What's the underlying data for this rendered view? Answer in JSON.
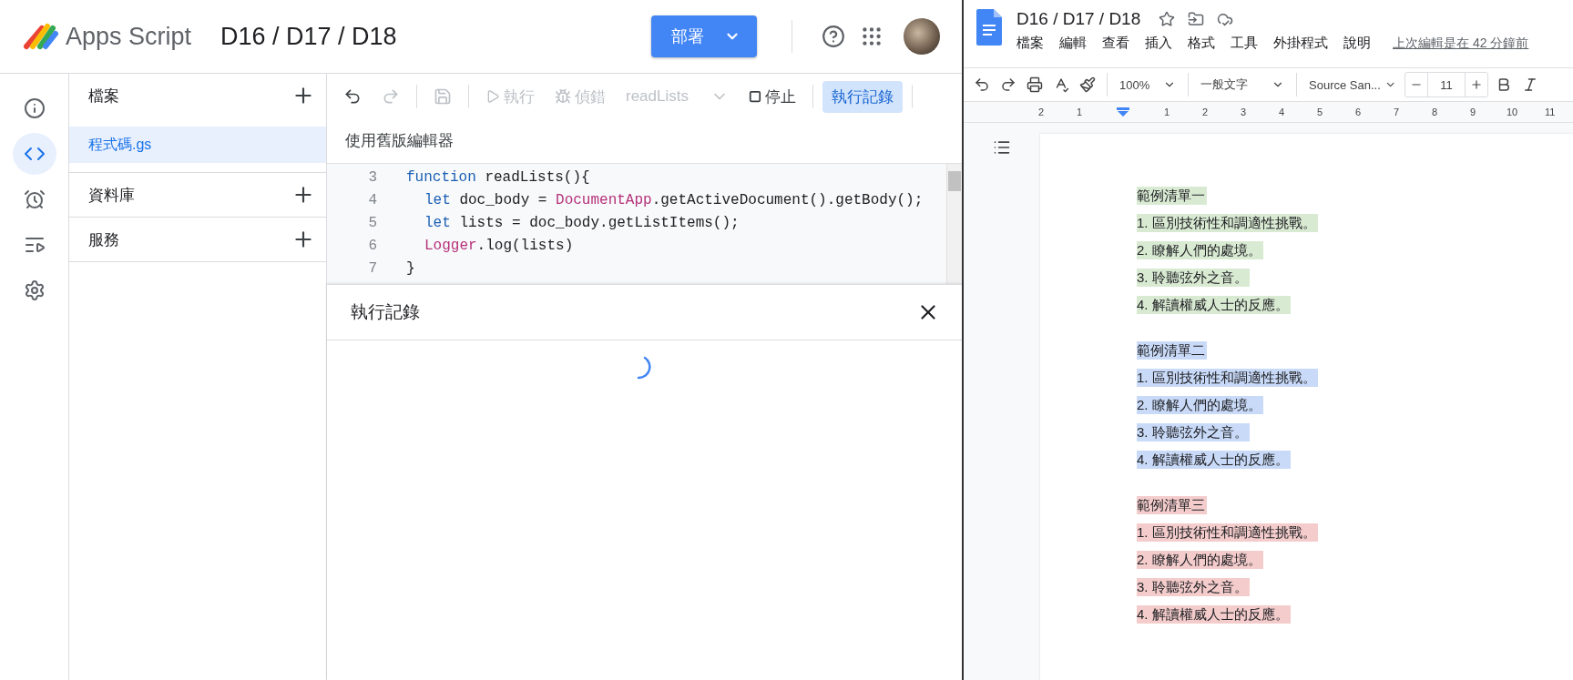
{
  "apps_script": {
    "brand": "Apps Script",
    "project_title": "D16 / D17 / D18",
    "deploy_button": "部署",
    "rail": [
      {
        "selected": false
      },
      {
        "selected": true
      },
      {
        "selected": false
      },
      {
        "selected": false
      },
      {
        "selected": false
      }
    ],
    "sections": [
      {
        "title": "檔案",
        "files": [
          {
            "name": "程式碼.gs",
            "selected": true
          }
        ]
      },
      {
        "title": "資料庫"
      },
      {
        "title": "服務"
      }
    ],
    "toolbar": {
      "run": {
        "label": "執行",
        "disabled": true
      },
      "debug": {
        "label": "偵錯",
        "disabled": true
      },
      "function_select": "readLists",
      "stop": "停止",
      "log_button": {
        "label": "執行記錄",
        "selected": true
      }
    },
    "legacy_link": "使用舊版編輯器",
    "code_lines": [
      {
        "number": "3",
        "tokens": [
          {
            "text": "function",
            "kind": "keyword"
          },
          {
            "text": " readLists(){",
            "kind": "plain"
          }
        ],
        "children": [
          {
            "number": "4",
            "tokens": [
              {
                "text": "let",
                "kind": "keyword"
              },
              {
                "text": " doc_body = ",
                "kind": "plain"
              },
              {
                "text": "DocumentApp",
                "kind": "class"
              },
              {
                "text": ".getActiveDocument().getBody();",
                "kind": "plain"
              }
            ]
          },
          {
            "number": "5",
            "tokens": [
              {
                "text": "let",
                "kind": "keyword"
              },
              {
                "text": " lists = doc_body.getListItems();",
                "kind": "plain"
              }
            ]
          },
          {
            "number": "6",
            "tokens": [
              {
                "text": "Logger",
                "kind": "class"
              },
              {
                "text": ".log(lists)",
                "kind": "plain"
              }
            ]
          }
        ]
      },
      {
        "number": "7",
        "tokens": [
          {
            "text": "}",
            "kind": "plain"
          }
        ]
      }
    ],
    "log_panel": {
      "title": "執行記錄",
      "loading": true
    }
  },
  "docs": {
    "title": "D16 / D17 / D18",
    "menu": [
      "檔案",
      "編輯",
      "查看",
      "插入",
      "格式",
      "工具",
      "外掛程式",
      "說明"
    ],
    "last_edit": "上次編輯是在 42 分鐘前",
    "toolbar": {
      "zoom": "100%",
      "style": "一般文字",
      "font": "Source San...",
      "font_size": "11"
    },
    "ruler": [
      "2",
      "1",
      "1",
      "2",
      "3",
      "4",
      "5",
      "6",
      "7",
      "8",
      "9",
      "10",
      "11"
    ],
    "lists": [
      {
        "heading": "範例清單一",
        "color": "#d9ead3",
        "items": [
          "1. 區別技術性和調適性挑戰。",
          "2. 瞭解人們的處境。",
          "3. 聆聽弦外之音。",
          "4. 解讀權威人士的反應。"
        ]
      },
      {
        "heading": "範例清單二",
        "color": "#c9daf8",
        "items": [
          "1. 區別技術性和調適性挑戰。",
          "2. 瞭解人們的處境。",
          "3. 聆聽弦外之音。",
          "4. 解讀權威人士的反應。"
        ]
      },
      {
        "heading": "範例清單三",
        "color": "#f4cccc",
        "items": [
          "1. 區別技術性和調適性挑戰。",
          "2. 瞭解人們的處境。",
          "3. 聆聽弦外之音。",
          "4. 解讀權威人士的反應。"
        ]
      }
    ]
  }
}
